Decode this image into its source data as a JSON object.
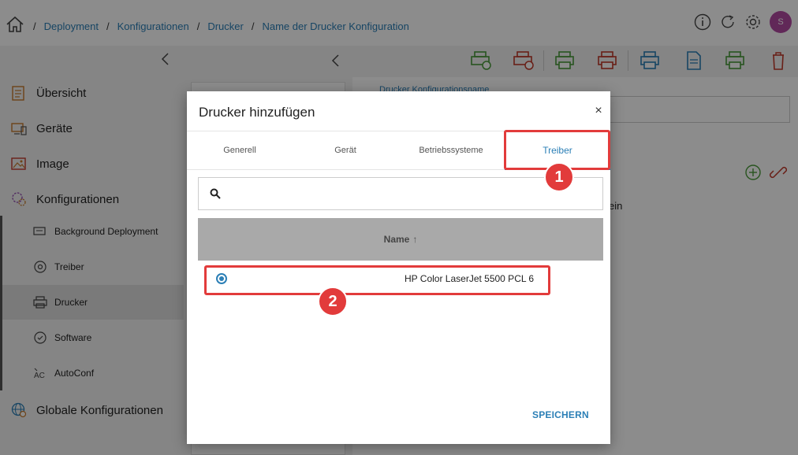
{
  "breadcrumb": {
    "items": [
      "Deployment",
      "Konfigurationen",
      "Drucker",
      "Name der Drucker Konfiguration"
    ],
    "separator": "/"
  },
  "header_icons": [
    "info-icon",
    "refresh-icon",
    "settings-icon"
  ],
  "user": {
    "avatar_initial": "S",
    "avatar_color": "#b14aa1"
  },
  "sidebar": {
    "items": [
      {
        "label": "Übersicht",
        "icon": "overview-icon"
      },
      {
        "label": "Geräte",
        "icon": "devices-icon"
      },
      {
        "label": "Image",
        "icon": "image-icon"
      },
      {
        "label": "Konfigurationen",
        "icon": "configurations-icon"
      }
    ],
    "sub_items": [
      {
        "label": "Background Deployment",
        "icon": "background-deployment-icon"
      },
      {
        "label": "Treiber",
        "icon": "driver-icon"
      },
      {
        "label": "Drucker",
        "icon": "printer-icon",
        "active": true
      },
      {
        "label": "Software",
        "icon": "software-icon"
      },
      {
        "label": "AutoConf",
        "icon": "autoconf-icon"
      }
    ],
    "global": {
      "label": "Globale Konfigurationen",
      "icon": "global-config-icon"
    }
  },
  "toolbar": {
    "icons": [
      "printer-add-green-icon",
      "printer-remove-red-icon",
      "printer-add-icon",
      "printer-delete-icon",
      "printer-settings-icon",
      "document-icon",
      "printer-print-icon",
      "trash-icon"
    ]
  },
  "background": {
    "config_name_label": "Drucker Konfigurationsname",
    "partial_text": "ein"
  },
  "modal": {
    "title": "Drucker hinzufügen",
    "close": "×",
    "tabs": [
      "Generell",
      "Gerät",
      "Betriebssysteme",
      "Treiber"
    ],
    "active_tab": "Treiber",
    "search": {
      "placeholder": "",
      "value": ""
    },
    "table": {
      "column": "Name",
      "sort_indicator": "↑",
      "rows": [
        {
          "name": "HP Color LaserJet 5500 PCL 6",
          "selected": true
        }
      ]
    },
    "save_label": "SPEICHERN"
  },
  "annotations": {
    "step1": "1",
    "step2": "2",
    "color": "#e23b3b"
  },
  "colors": {
    "accent": "#2b7fb6",
    "sidebar_bg": "#f2f2f2"
  }
}
